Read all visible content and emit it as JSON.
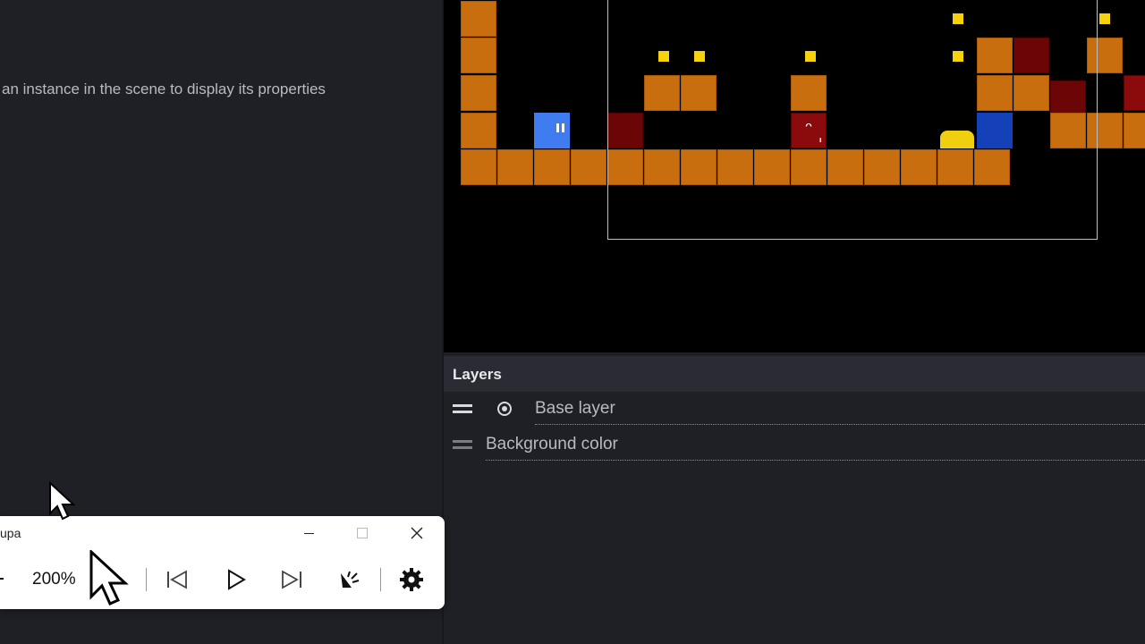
{
  "properties_panel": {
    "hint": "an instance in the scene to display its properties"
  },
  "layers_panel": {
    "title": "Layers",
    "layers": [
      {
        "label": "Base layer",
        "visible_icon": "radio-icon"
      },
      {
        "label": "Background color"
      }
    ]
  },
  "magnifier": {
    "title": "upa",
    "zoom": "200%",
    "buttons": [
      "minimize",
      "maximize",
      "close",
      "previous",
      "play",
      "next",
      "read-aloud",
      "settings"
    ]
  },
  "colors": {
    "scene_background": "#000000",
    "tile": "#c86e0e",
    "dark_tile": "#6b0506",
    "coin": "#f5d20a",
    "player": "#3f7cf0"
  }
}
